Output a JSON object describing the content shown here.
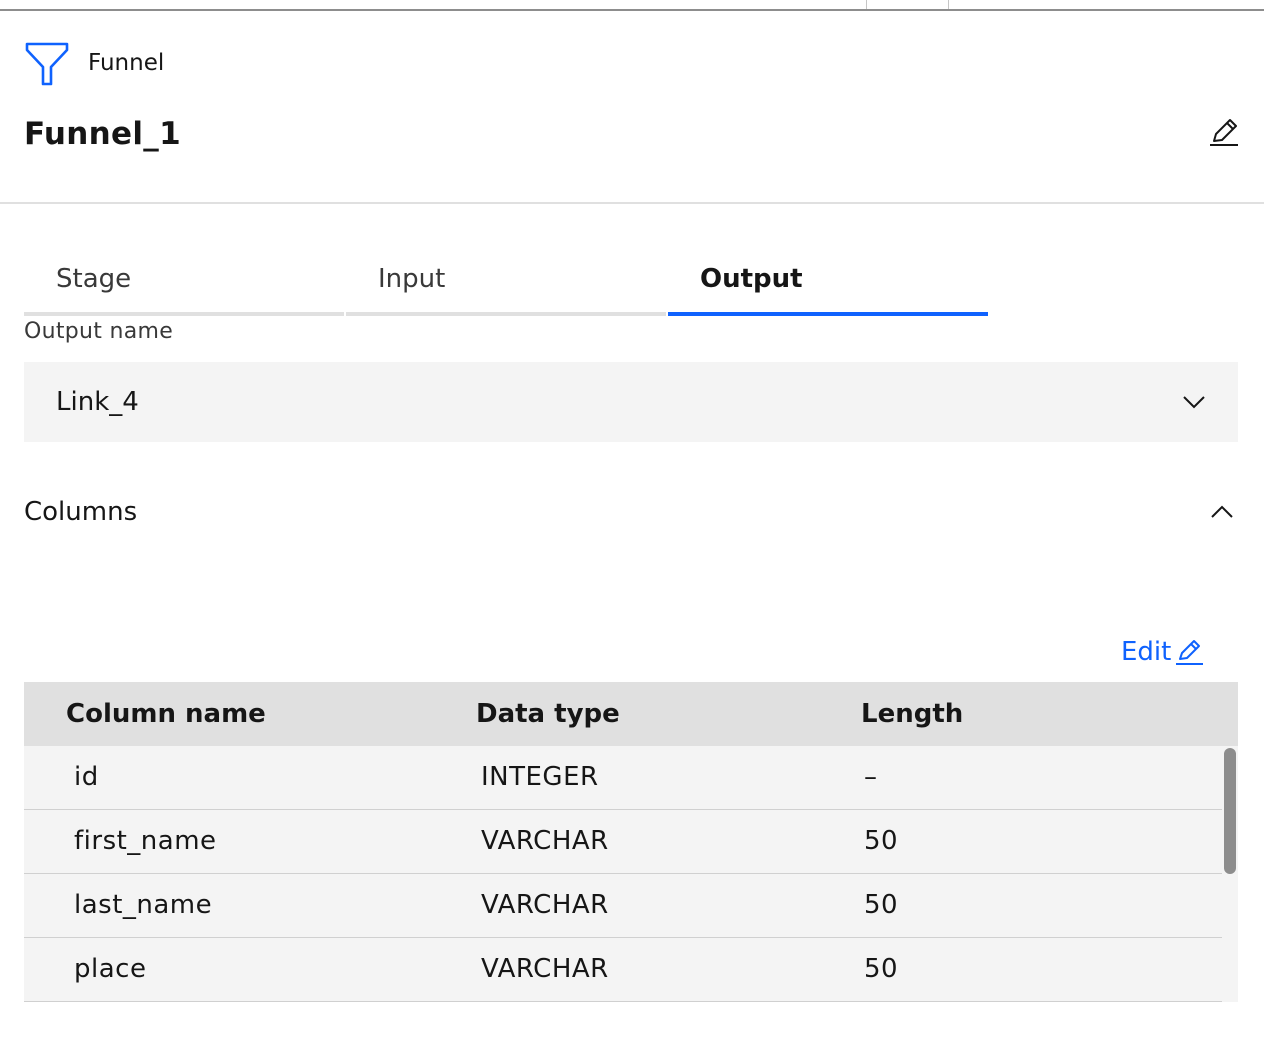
{
  "node": {
    "type_label": "Funnel",
    "title": "Funnel_1"
  },
  "tabs": [
    {
      "label": "Stage",
      "active": false
    },
    {
      "label": "Input",
      "active": false
    },
    {
      "label": "Output",
      "active": true
    }
  ],
  "output": {
    "field_label": "Output name",
    "selected_value": "Link_4"
  },
  "columns_section": {
    "label": "Columns",
    "expanded": true,
    "edit_label": "Edit",
    "headers": [
      "Column name",
      "Data type",
      "Length"
    ],
    "rows": [
      [
        "id",
        "INTEGER",
        "–"
      ],
      [
        "first_name",
        "VARCHAR",
        "50"
      ],
      [
        "last_name",
        "VARCHAR",
        "50"
      ],
      [
        "place",
        "VARCHAR",
        "50"
      ]
    ]
  },
  "colors": {
    "accent": "#0f62fe",
    "funnel_icon": "#0f62fe",
    "header_bg": "#e0e0e0",
    "field_bg": "#f4f4f4"
  },
  "icons": [
    "funnel-icon",
    "pencil-icon",
    "chevron-down-icon",
    "chevron-up-icon"
  ]
}
